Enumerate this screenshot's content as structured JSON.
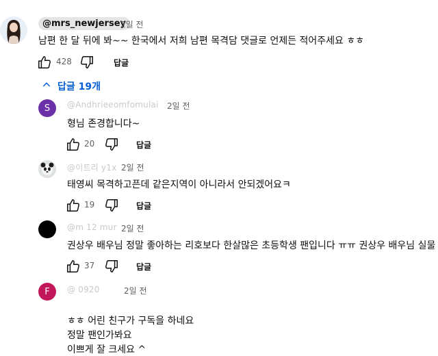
{
  "top_comment": {
    "handle": "@mrs_newjersey",
    "time": "2일 전",
    "text": "남편 한 달 뒤에 봐~~ 한국에서 저희 남편 목격담 댓글로 언제든 적어주세요 ㅎㅎ",
    "likes": "428",
    "reply_label": "답글"
  },
  "replies_toggle": {
    "label": "답글 19개",
    "icon": "chevron-up-icon"
  },
  "replies": [
    {
      "avatar_letter": "S",
      "avatar_color": "#6b2fa8",
      "handle_faded": "@Andhrieeomfomulai",
      "time": "2일 전",
      "text": "형님 존경합니다~",
      "likes": "20",
      "reply_label": "답글"
    },
    {
      "avatar_color": "#e0e0e0",
      "handle_faded": "@이트리 y1x",
      "time": "2일 전",
      "text": "태영씨 목격하고픈데 같은지역이 아니라서 안되겠어요ㅋ",
      "likes": "19",
      "reply_label": "답글"
    },
    {
      "avatar_color": "#000000",
      "handle_faded": "@m 12 mur",
      "time": "2일 전",
      "text": "권상우 배우님 정말 좋아하는 리호보다 한살많은 초등학생 팬입니다 ㅠㅠ 권상우 배우님 실물",
      "likes": "37",
      "reply_label": "답글"
    },
    {
      "avatar_letter": "F",
      "avatar_color": "#c2185b",
      "handle_faded": "@ 0920",
      "time": "2일 전",
      "text_lines": [
        "ㅎㅎ 어린 친구가 구독을 하네요",
        "정말 팬인가봐요",
        "이쁘게 잘 크세요 ^"
      ]
    }
  ]
}
